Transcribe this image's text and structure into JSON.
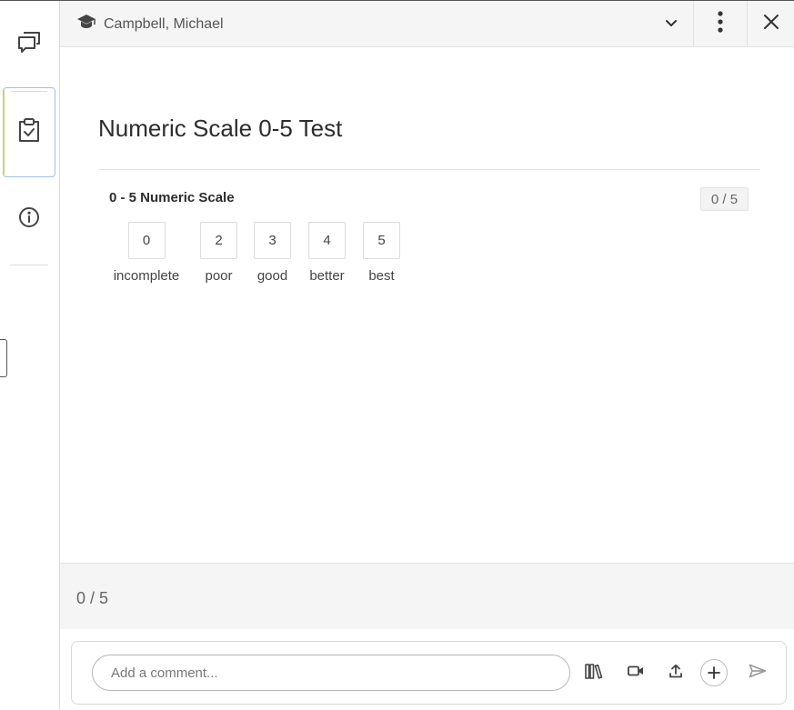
{
  "header": {
    "student_icon": "graduation-cap-icon",
    "student_name": "Campbell, Michael",
    "chevron_icon": "chevron-down-icon",
    "more_icon": "more-vertical-icon",
    "close_icon": "close-icon"
  },
  "rail": {
    "items": [
      {
        "name": "comments",
        "icon": "comments-icon"
      },
      {
        "name": "rubric",
        "icon": "clipboard-check-icon",
        "active": true
      },
      {
        "name": "info",
        "icon": "info-icon"
      }
    ]
  },
  "rubric": {
    "title": "Numeric Scale 0-5 Test",
    "criterion": {
      "name": "0 - 5 Numeric Scale",
      "score": "0 / 5",
      "ratings": [
        {
          "value": "0",
          "label": "incomplete"
        },
        {
          "value": "2",
          "label": "poor"
        },
        {
          "value": "3",
          "label": "good"
        },
        {
          "value": "4",
          "label": "better"
        },
        {
          "value": "5",
          "label": "best"
        }
      ]
    }
  },
  "total": {
    "score": "0 / 5"
  },
  "comment": {
    "placeholder": "Add a comment...",
    "value": "",
    "icons": [
      "library-icon",
      "video-icon",
      "upload-icon",
      "add-icon",
      "send-icon"
    ]
  },
  "colors": {
    "active_border": "#9cc3ea",
    "active_accent": "#c9d27a",
    "icon": "#444444"
  }
}
